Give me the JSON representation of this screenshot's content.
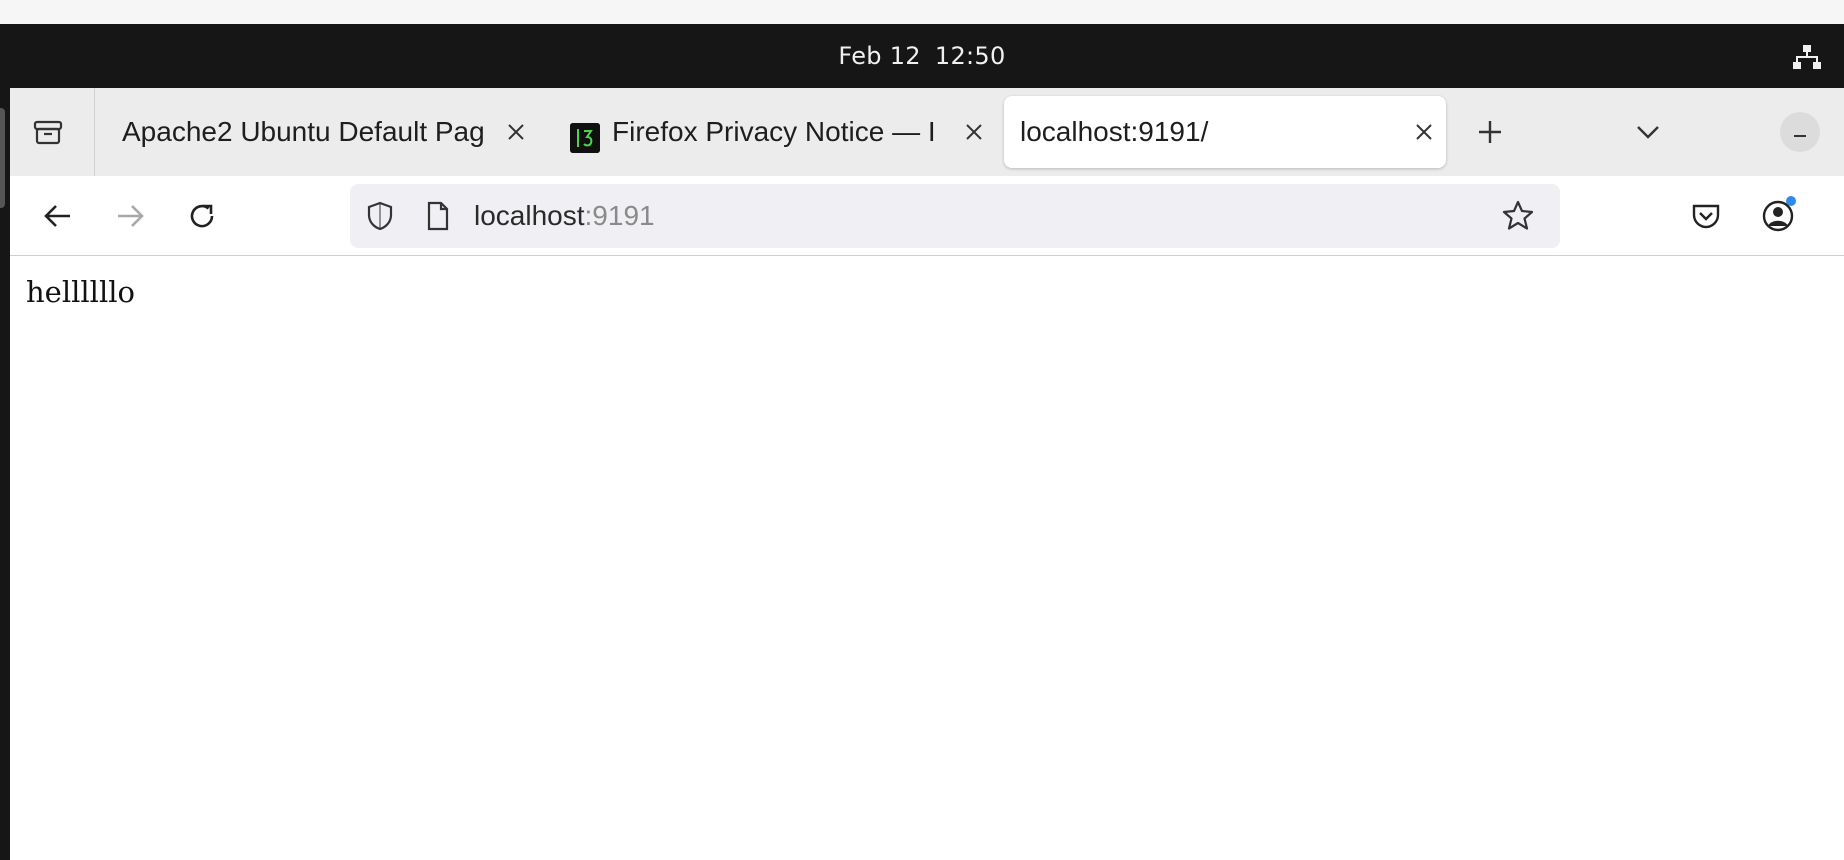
{
  "system_bar": {
    "date": "Feb 12",
    "time": "12:50",
    "network_icon": "network-wired-icon"
  },
  "tabs": [
    {
      "title": "Apache2 Ubuntu Default Pag",
      "icon": "none",
      "active": false
    },
    {
      "title": "Firefox Privacy Notice — I",
      "icon": "terminal-icon",
      "active": false
    },
    {
      "title": "localhost:9191/",
      "icon": "none",
      "active": true
    }
  ],
  "toolbar": {
    "url_host": "localhost",
    "url_port": ":9191"
  },
  "page": {
    "body_text": "hellllllo"
  },
  "colors": {
    "system_bar": "#161616",
    "tabbar": "#ececec",
    "urlbar": "#f0f0f4",
    "notification_dot": "#2f8ae8"
  }
}
